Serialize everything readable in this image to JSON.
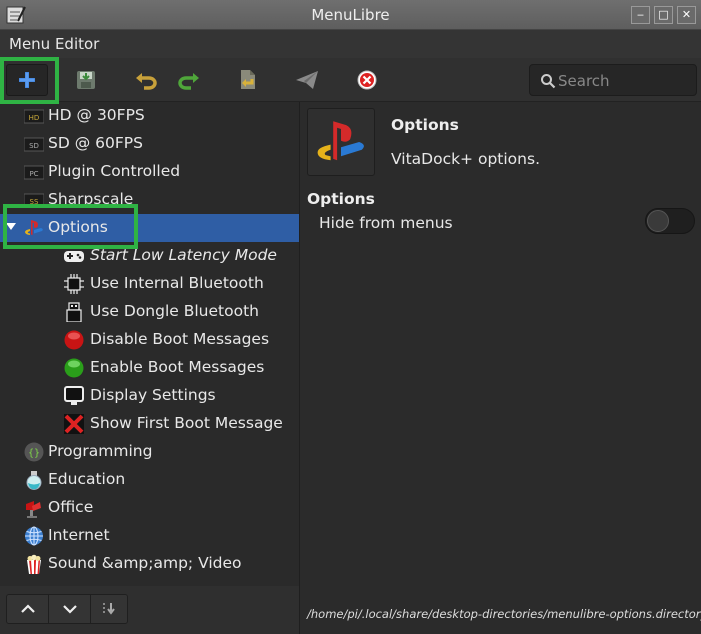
{
  "window": {
    "title": "MenuLibre"
  },
  "menubar": {
    "label": "Menu Editor"
  },
  "toolbar": {
    "search_placeholder": "Search",
    "buttons": [
      {
        "name": "add-button",
        "icon": "plus-icon",
        "color": "#3a7bd5"
      },
      {
        "name": "save-button",
        "icon": "save-icon"
      },
      {
        "name": "undo-button",
        "icon": "undo-icon",
        "color": "#c8a13a"
      },
      {
        "name": "redo-button",
        "icon": "redo-icon",
        "color": "#4fa63a"
      },
      {
        "name": "revert-button",
        "icon": "revert-icon"
      },
      {
        "name": "test-launch-button",
        "icon": "send-icon"
      },
      {
        "name": "delete-button",
        "icon": "delete-icon",
        "color": "#d22"
      }
    ]
  },
  "tree": [
    {
      "label": "HD @ 30FPS",
      "icon": "hd-badge-icon",
      "badge": "HD"
    },
    {
      "label": "SD @ 60FPS",
      "icon": "sd-badge-icon",
      "badge": "SD"
    },
    {
      "label": "Plugin Controlled",
      "icon": "pc-badge-icon",
      "badge": "PC"
    },
    {
      "label": "Sharpscale",
      "icon": "ss-badge-icon",
      "badge": "SS"
    },
    {
      "label": "Options",
      "icon": "playstation-icon",
      "selected": true,
      "expanded": true
    },
    {
      "label": "Start Low Latency Mode",
      "icon": "gamepad-icon",
      "italic": true
    },
    {
      "label": "Use Internal Bluetooth",
      "icon": "chip-icon"
    },
    {
      "label": "Use Dongle Bluetooth",
      "icon": "usb-dongle-icon"
    },
    {
      "label": "Disable Boot Messages",
      "icon": "red-circle-icon"
    },
    {
      "label": "Enable Boot Messages",
      "icon": "green-circle-icon"
    },
    {
      "label": "Display Settings",
      "icon": "monitor-icon"
    },
    {
      "label": "Show First Boot Message",
      "icon": "red-x-icon"
    },
    {
      "label": "Programming",
      "icon": "programming-icon"
    },
    {
      "label": "Education",
      "icon": "flask-icon"
    },
    {
      "label": "Office",
      "icon": "office-icon"
    },
    {
      "label": "Internet",
      "icon": "globe-icon"
    },
    {
      "label": "Sound &amp;amp; Video",
      "icon": "popcorn-icon"
    }
  ],
  "detail": {
    "name": "Options",
    "comment": "VitaDock+ options.",
    "section": "Options",
    "hide_label": "Hide from menus",
    "hide_enabled": false,
    "path": "/home/pi/.local/share/desktop-directories/menulibre-options.directory"
  },
  "colors": {
    "selection": "#2f5ea5",
    "highlight": "#2fb344",
    "background": "#2b2b2b"
  }
}
